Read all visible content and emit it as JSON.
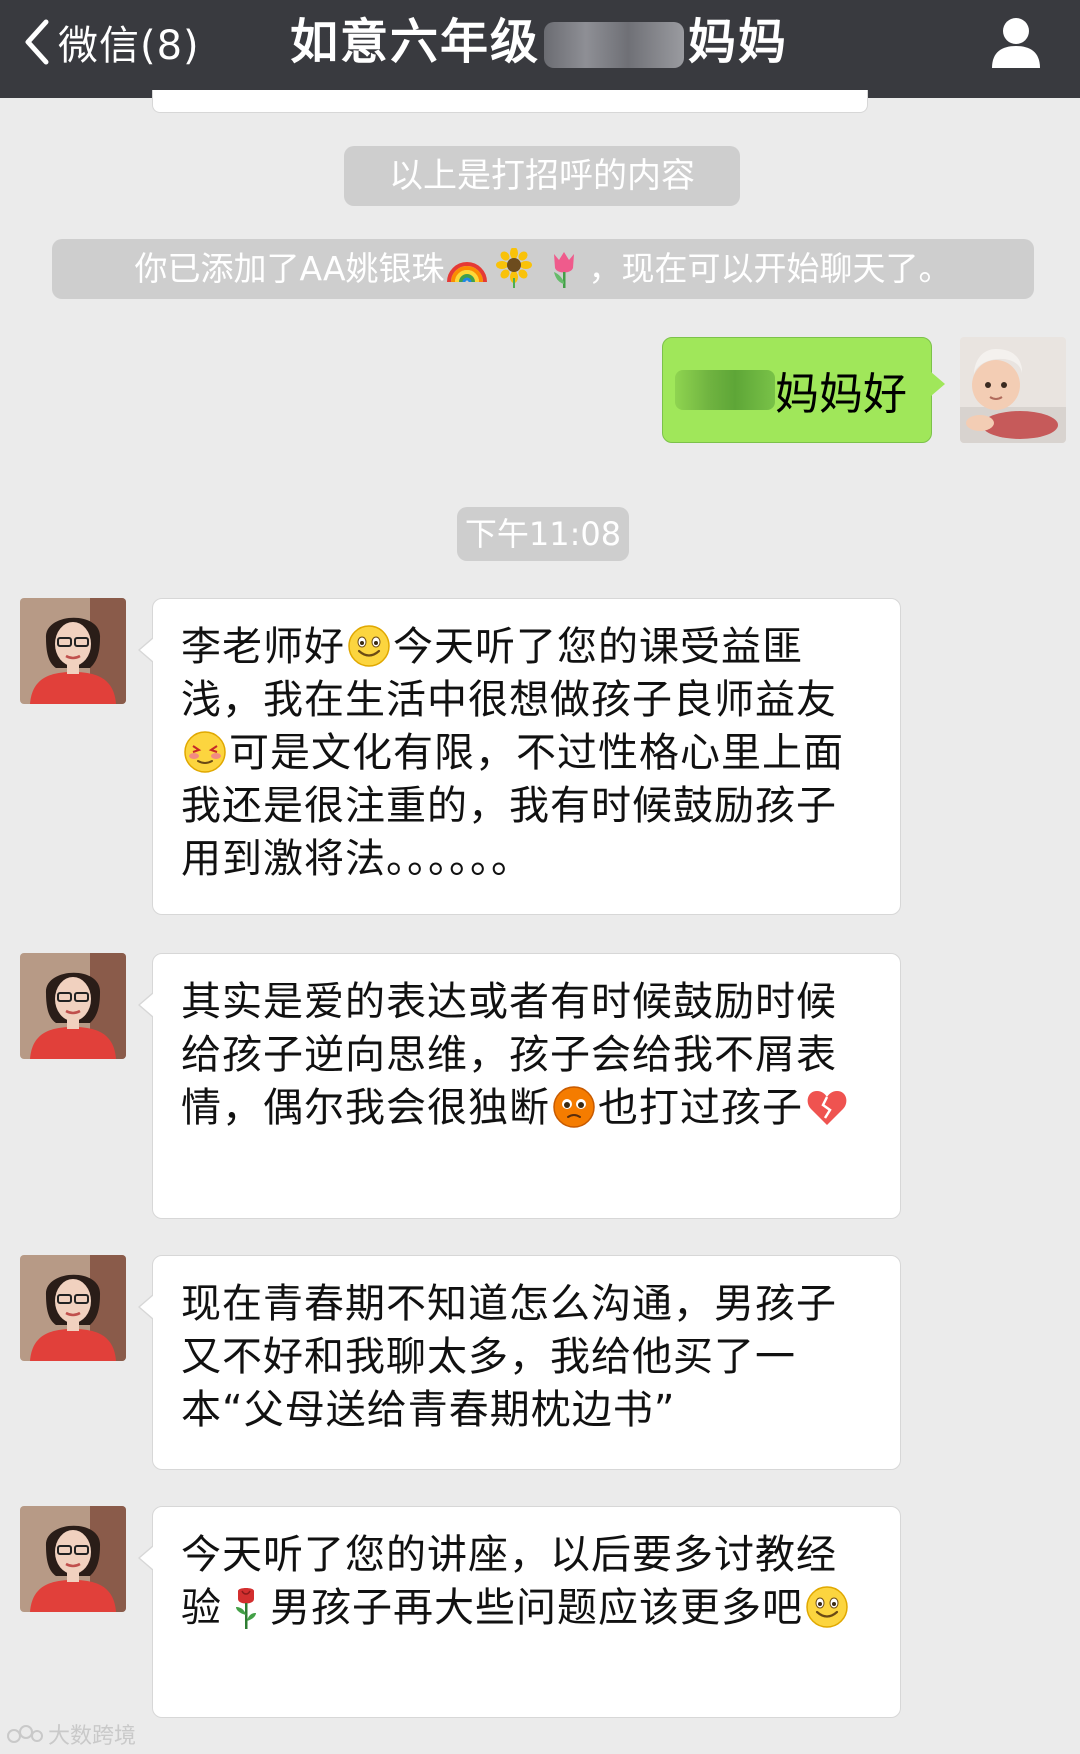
{
  "header": {
    "back_label": "微信(8)",
    "title_prefix": "如意六年级",
    "title_suffix": "妈妈"
  },
  "system_messages": {
    "greeting_note": "以上是打招呼的内容",
    "added_prefix": "你已添加了AA姚银珠",
    "added_suffix": "，现在可以开始聊天了。",
    "timestamp": "下午11:08"
  },
  "outgoing": {
    "text": "妈妈好"
  },
  "messages": [
    {
      "seg1": "李老师好",
      "seg2": "今天听了您的课受益匪浅，我在生活中很想做孩子良师益友",
      "seg3": "可是文化有限，不过性格心里上面我还是很注重的，我有时候鼓励孩子用到激将法。。。。。。"
    },
    {
      "seg1": "其实是爱的表达或者有时候鼓励时候给孩子逆向思维，孩子会给我不屑表情，偶尔我会很独断",
      "seg2": "也打过孩子"
    },
    {
      "seg1": "现在青春期不知道怎么沟通，男孩子又不好和我聊太多，我给他买了一本“父母送给青春期枕边书”"
    },
    {
      "seg1": "今天听了您的讲座，以后要多讨教经验",
      "seg2": "男孩子再大些问题应该更多吧"
    }
  ],
  "watermark": "大数跨境",
  "icons": [
    "chevron-left-icon",
    "person-icon",
    "rainbow-icon",
    "sunflower-icon",
    "tulip-icon",
    "smile-icon",
    "blush-icon",
    "pleading-icon",
    "broken-heart-icon",
    "rose-icon"
  ],
  "colors": {
    "topbar": "#393a3f",
    "background": "#ebebeb",
    "outgoing_bubble": "#a0e75a",
    "incoming_bubble": "#ffffff",
    "system_pill": "#cecece"
  }
}
